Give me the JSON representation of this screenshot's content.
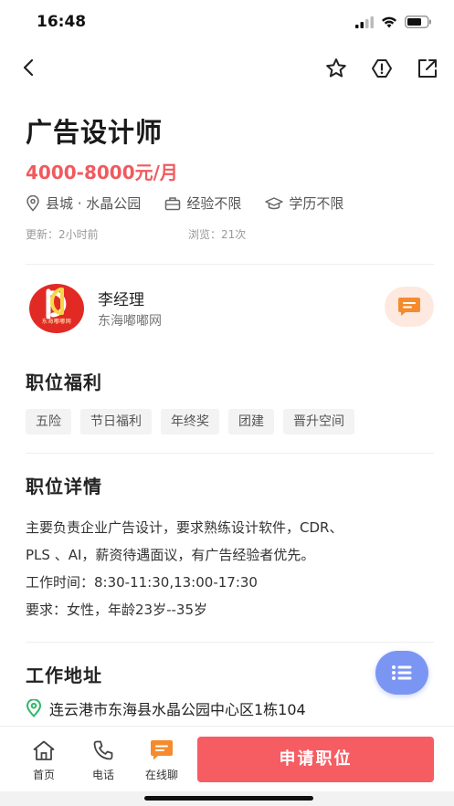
{
  "status_bar": {
    "time": "16:48"
  },
  "job": {
    "title": "广告设计师",
    "salary": "4000-8000元/月",
    "location": "县城 · 水晶公园",
    "experience": "经验不限",
    "education": "学历不限",
    "updated": "更新：2小时前",
    "views": "浏览：21次"
  },
  "recruiter": {
    "name": "李经理",
    "company": "东海嘟嘟网",
    "logo_text": "东海嘟嘟网"
  },
  "benefits": {
    "title": "职位福利",
    "items": [
      "五险",
      "节日福利",
      "年终奖",
      "团建",
      "晋升空间"
    ]
  },
  "details": {
    "title": "职位详情",
    "lines": [
      "主要负责企业广告设计，要求熟练设计软件，CDR、",
      "PLS 、AI，薪资待遇面议，有广告经验者优先。",
      "工作时间：8:30-11:30,13:00-17:30",
      "要求：女性，年龄23岁--35岁"
    ]
  },
  "address": {
    "title": "工作地址",
    "text": "连云港市东海县水晶公园中心区1栋104"
  },
  "bottom_bar": {
    "home_label": "首页",
    "phone_label": "电话",
    "chat_label": "在线聊",
    "apply_label": "申请职位"
  },
  "colors": {
    "accent": "#f05a5f",
    "apply": "#f55d63",
    "chat": "#f68b2e",
    "fab": "#7b96f2",
    "location_icon": "#2fb86a"
  },
  "icons": {
    "back": "chevron-left-icon",
    "favorite": "star-icon",
    "report": "warning-icon",
    "share": "share-icon"
  }
}
